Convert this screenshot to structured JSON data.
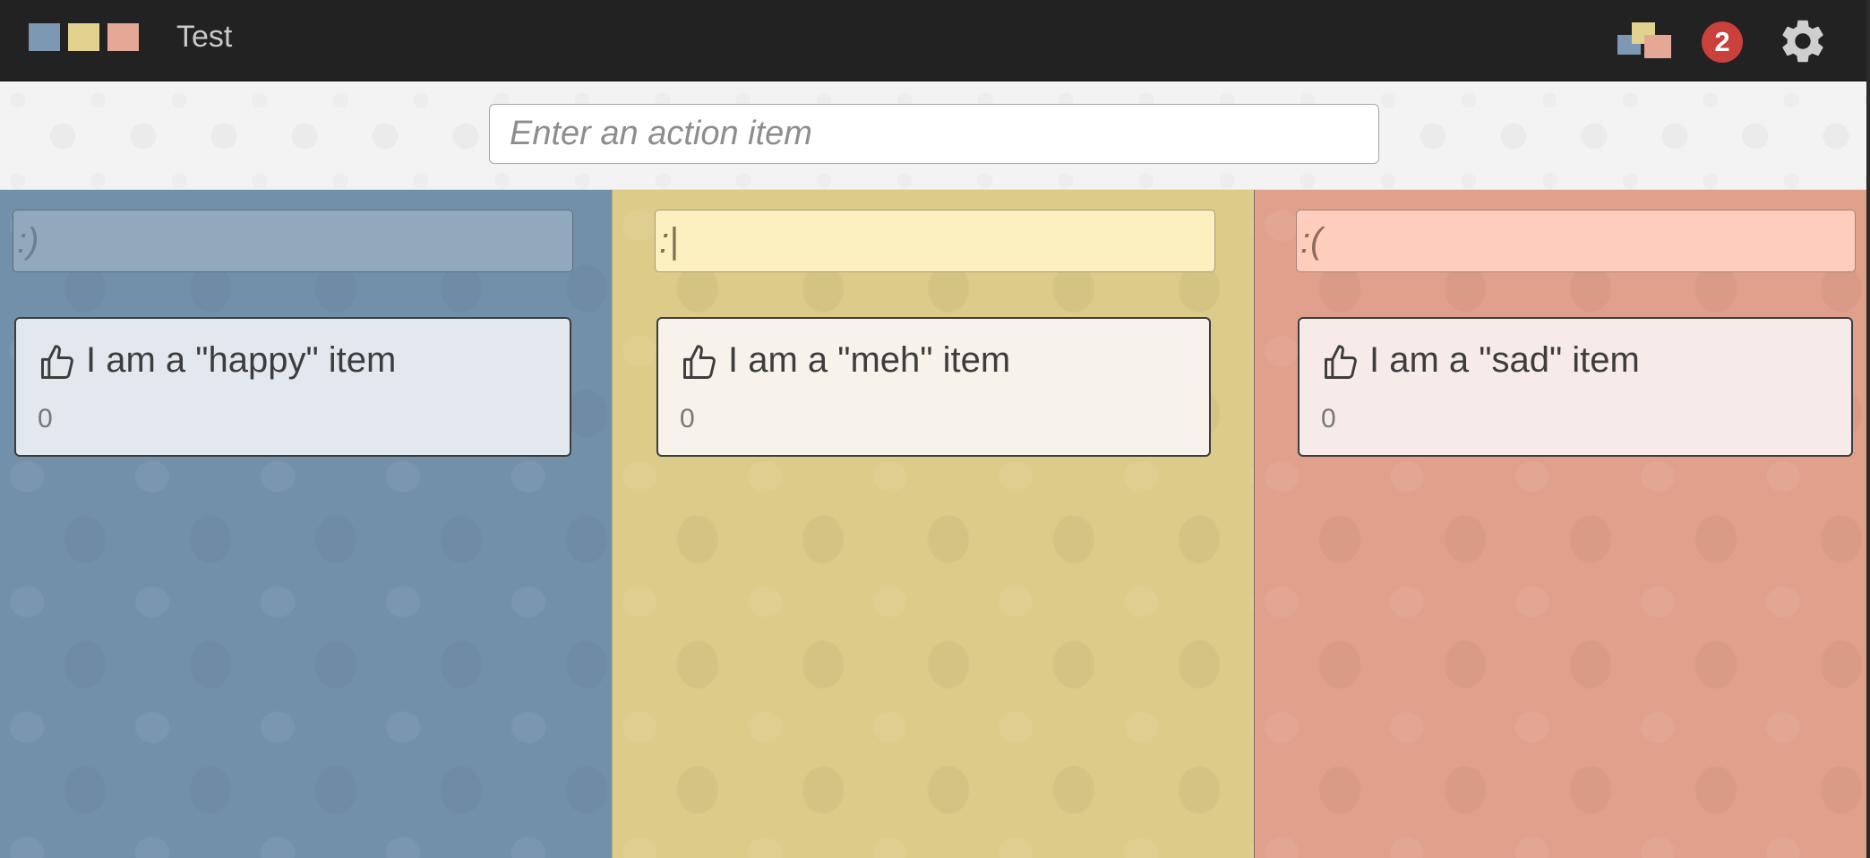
{
  "header": {
    "logo_colors": [
      "#7d98b2",
      "#e2d290",
      "#e5a897"
    ],
    "board_title": "Test",
    "boards_icon": "stacked-boards-icon",
    "notification_count": "2",
    "settings_icon": "gear-icon"
  },
  "action_bar": {
    "placeholder": "Enter an action item",
    "value": ""
  },
  "columns": [
    {
      "key": "happy",
      "header_value": ":)",
      "bg_color": "#7390ab",
      "header_bg": "#91a9bd",
      "header_text_color": "#6a7f92",
      "card_bg": "#e2e8ee",
      "items": [
        {
          "text": "I am a \"happy\" item",
          "votes": "0"
        }
      ]
    },
    {
      "key": "meh",
      "header_value": ":|",
      "bg_color": "#dccb89",
      "header_bg": "#fdf0c0",
      "header_text_color": "#7d7252",
      "card_bg": "#f7f3ea",
      "items": [
        {
          "text": "I am a \"meh\" item",
          "votes": "0"
        }
      ]
    },
    {
      "key": "sad",
      "header_value": ":(",
      "bg_color": "#e1a08b",
      "header_bg": "#ffcdbd",
      "header_text_color": "#8f6a5d",
      "card_bg": "#f6ebe8",
      "items": [
        {
          "text": "I am a \"sad\" item",
          "votes": "0"
        }
      ]
    }
  ]
}
